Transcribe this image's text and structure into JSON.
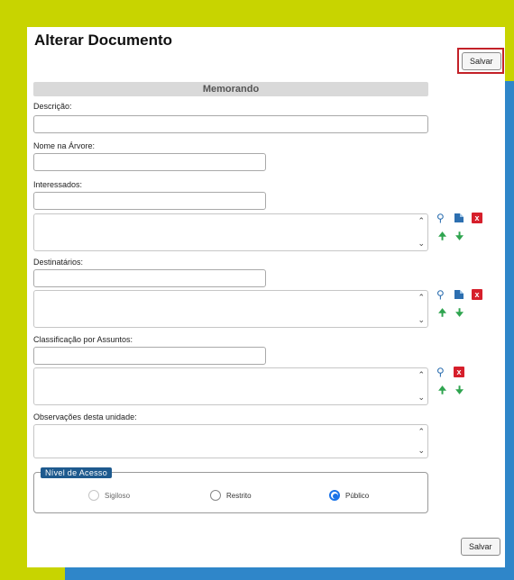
{
  "page": {
    "title": "Alterar Documento",
    "save_label": "Salvar"
  },
  "form": {
    "section_title": "Memorando",
    "descricao": {
      "label": "Descrição:",
      "value": ""
    },
    "nome_arvore": {
      "label": "Nome na Árvore:",
      "value": ""
    },
    "interessados": {
      "label": "Interessados:",
      "value": ""
    },
    "destinatarios": {
      "label": "Destinatários:",
      "value": ""
    },
    "classificacao": {
      "label": "Classificação por Assuntos:",
      "value": ""
    },
    "observacoes": {
      "label": "Observações desta unidade:",
      "value": ""
    }
  },
  "nivel_acesso": {
    "legend": "Nível de Acesso",
    "options": [
      {
        "label": "Sigiloso",
        "state": "disabled"
      },
      {
        "label": "Restrito",
        "state": "unchecked"
      },
      {
        "label": "Público",
        "state": "checked"
      }
    ]
  },
  "icons": {
    "search": "search-icon",
    "edit": "edit-icon",
    "remove": "remove-icon",
    "up": "arrow-up-icon",
    "down": "arrow-down-icon"
  },
  "colors": {
    "background_outer": "#c8d400",
    "background_inner": "#2f86c9",
    "highlight_border": "#c32128",
    "legend_bg": "#1e5a8e",
    "remove_icon": "#d61f2b",
    "arrows": "#2fa44f",
    "radio_selected": "#1a73e8"
  }
}
